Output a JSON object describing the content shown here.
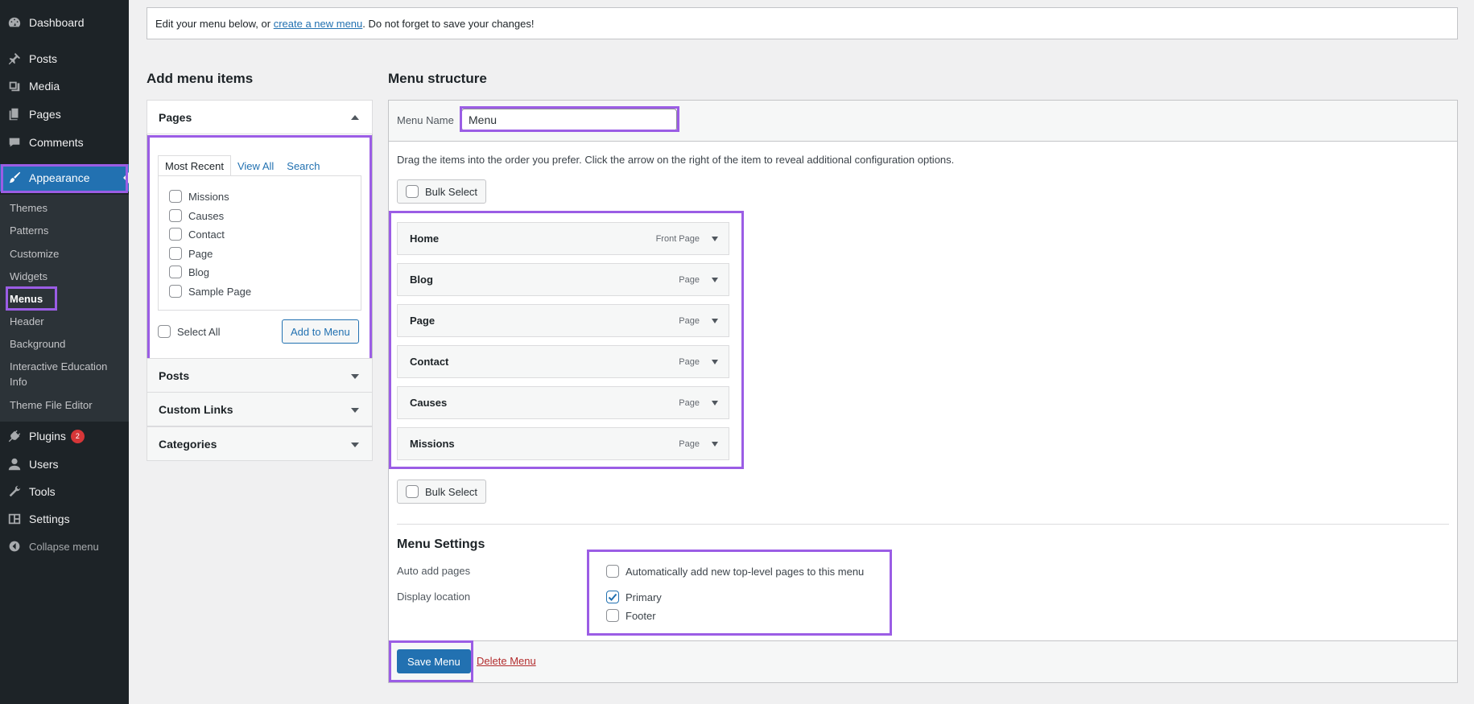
{
  "sidebar": {
    "dashboard": "Dashboard",
    "posts": "Posts",
    "media": "Media",
    "pages": "Pages",
    "comments": "Comments",
    "appearance": "Appearance",
    "submenu": [
      "Themes",
      "Patterns",
      "Customize",
      "Widgets",
      "Menus",
      "Header",
      "Background",
      "Interactive Education Info",
      "Theme File Editor"
    ],
    "plugins": "Plugins",
    "plugins_badge": "2",
    "users": "Users",
    "tools": "Tools",
    "settings": "Settings",
    "collapse": "Collapse menu"
  },
  "notice": {
    "prefix": "Edit your menu below, or ",
    "link": "create a new menu",
    "suffix": ". Do not forget to save your changes!"
  },
  "add_items": {
    "heading": "Add menu items",
    "pages": {
      "title": "Pages",
      "tabs": [
        "Most Recent",
        "View All",
        "Search"
      ],
      "items": [
        "Missions",
        "Causes",
        "Contact",
        "Page",
        "Blog",
        "Sample Page"
      ],
      "select_all": "Select All",
      "add_button": "Add to Menu"
    },
    "sections": [
      "Posts",
      "Custom Links",
      "Categories"
    ]
  },
  "structure": {
    "heading": "Menu structure",
    "name_label": "Menu Name",
    "name_value": "Menu",
    "instructions": "Drag the items into the order you prefer. Click the arrow on the right of the item to reveal additional configuration options.",
    "bulk_select": "Bulk Select",
    "items": [
      {
        "title": "Home",
        "type": "Front Page"
      },
      {
        "title": "Blog",
        "type": "Page"
      },
      {
        "title": "Page",
        "type": "Page"
      },
      {
        "title": "Contact",
        "type": "Page"
      },
      {
        "title": "Causes",
        "type": "Page"
      },
      {
        "title": "Missions",
        "type": "Page"
      }
    ]
  },
  "settings": {
    "heading": "Menu Settings",
    "auto_add_label": "Auto add pages",
    "auto_add_option": "Automatically add new top-level pages to this menu",
    "display_label": "Display location",
    "locations": [
      {
        "name": "Primary",
        "checked": true
      },
      {
        "name": "Footer",
        "checked": false
      }
    ]
  },
  "footer": {
    "save": "Save Menu",
    "delete": "Delete Menu"
  },
  "colors": {
    "accent": "#2271b1",
    "highlight": "#9b5de5",
    "sidebar": "#1d2327",
    "danger": "#b32d2e",
    "badge": "#d63638"
  }
}
